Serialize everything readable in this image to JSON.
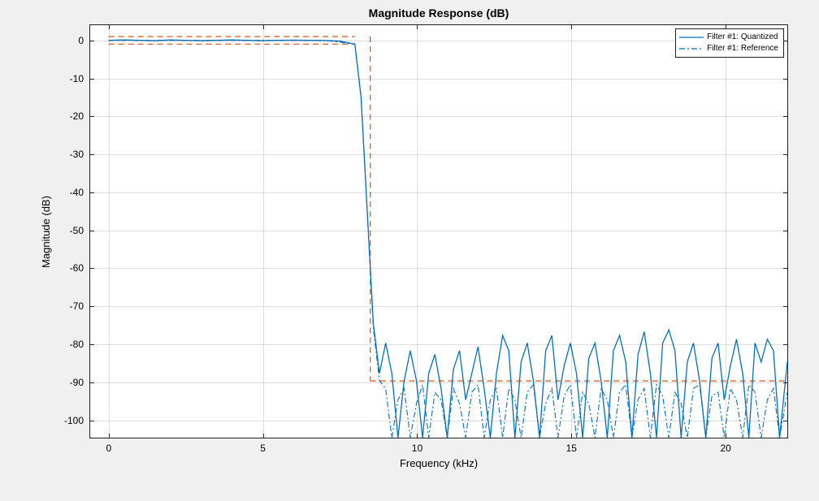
{
  "title": "Magnitude Response (dB)",
  "xlabel": "Frequency (kHz)",
  "ylabel": "Magnitude (dB)",
  "legend": {
    "items": [
      {
        "label": "Filter #1: Quantized",
        "style": "solid",
        "color": "#0072BD"
      },
      {
        "label": "Filter #1: Reference",
        "style": "dashdot",
        "color": "#0072BD"
      }
    ]
  },
  "colors": {
    "quantized": "#0072BD",
    "reference": "#0072BD",
    "mask": "#D95319"
  },
  "chart_data": {
    "type": "line",
    "xlabel": "Frequency (kHz)",
    "ylabel": "Magnitude (dB)",
    "title": "Magnitude Response (dB)",
    "xlim": [
      -0.6,
      22.05
    ],
    "ylim": [
      -105,
      4
    ],
    "xticks": [
      0,
      5,
      10,
      15,
      20
    ],
    "yticks": [
      0,
      -10,
      -20,
      -30,
      -40,
      -50,
      -60,
      -70,
      -80,
      -90,
      -100
    ],
    "grid": true,
    "legend_position": "northeast",
    "mask": {
      "color": "#D95319",
      "style": "dashed",
      "segments": [
        {
          "x": [
            0,
            8
          ],
          "y": [
            1,
            1
          ]
        },
        {
          "x": [
            0,
            8
          ],
          "y": [
            -1,
            -1
          ]
        },
        {
          "x": [
            8.5,
            8.5
          ],
          "y": [
            1,
            -90
          ]
        },
        {
          "x": [
            8.5,
            22.05
          ],
          "y": [
            -90,
            -90
          ]
        }
      ]
    },
    "series": [
      {
        "name": "Filter #1: Quantized",
        "color": "#0072BD",
        "style": "solid",
        "x": [
          0,
          0.5,
          1,
          1.5,
          2,
          2.5,
          3,
          3.5,
          4,
          4.5,
          5,
          5.5,
          6,
          6.5,
          7,
          7.5,
          8,
          8.2,
          8.4,
          8.6,
          8.8,
          9,
          9.2,
          9.4,
          9.6,
          9.8,
          10,
          10.2,
          10.4,
          10.6,
          10.8,
          11,
          11.2,
          11.4,
          11.6,
          11.8,
          12,
          12.2,
          12.4,
          12.6,
          12.8,
          13,
          13.2,
          13.4,
          13.6,
          13.8,
          14,
          14.2,
          14.4,
          14.6,
          14.8,
          15,
          15.2,
          15.4,
          15.6,
          15.8,
          16,
          16.2,
          16.4,
          16.6,
          16.8,
          17,
          17.2,
          17.4,
          17.6,
          17.8,
          18,
          18.2,
          18.4,
          18.6,
          18.8,
          19,
          19.2,
          19.4,
          19.6,
          19.8,
          20,
          20.2,
          20.4,
          20.6,
          20.8,
          21,
          21.2,
          21.4,
          21.6,
          21.8,
          22.05
        ],
        "y": [
          0,
          0.1,
          0,
          -0.1,
          0.1,
          0,
          -0.1,
          0,
          0.1,
          0,
          -0.1,
          0,
          0.05,
          0,
          -0.05,
          -0.2,
          -1,
          -15,
          -45,
          -75,
          -88,
          -80,
          -88,
          -105,
          -90,
          -82,
          -90,
          -105,
          -88,
          -83,
          -92,
          -105,
          -87,
          -82,
          -95,
          -88,
          -81,
          -92,
          -105,
          -88,
          -78,
          -82,
          -105,
          -85,
          -80,
          -90,
          -105,
          -82,
          -78,
          -95,
          -86,
          -80,
          -88,
          -105,
          -84,
          -80,
          -90,
          -105,
          -82,
          -78,
          -85,
          -105,
          -83,
          -77,
          -88,
          -105,
          -80,
          -76.5,
          -82,
          -105,
          -85,
          -80,
          -90,
          -105,
          -84,
          -80,
          -95,
          -86,
          -79,
          -88,
          -105,
          -80,
          -85,
          -79,
          -82,
          -105,
          -85
        ]
      },
      {
        "name": "Filter #1: Reference",
        "color": "#0072BD",
        "style": "dashdot",
        "x": [
          0,
          1,
          2,
          3,
          4,
          5,
          6,
          7,
          8,
          8.2,
          8.4,
          8.6,
          8.8,
          9,
          9.2,
          9.4,
          9.6,
          9.8,
          10,
          10.2,
          10.4,
          10.6,
          10.8,
          11,
          11.2,
          11.4,
          11.6,
          11.8,
          12,
          12.2,
          12.4,
          12.6,
          12.8,
          13,
          13.2,
          13.4,
          13.6,
          13.8,
          14,
          14.2,
          14.4,
          14.6,
          14.8,
          15,
          15.2,
          15.4,
          15.6,
          15.8,
          16,
          16.2,
          16.4,
          16.6,
          16.8,
          17,
          17.2,
          17.4,
          17.6,
          17.8,
          18,
          18.2,
          18.4,
          18.6,
          18.8,
          19,
          19.2,
          19.4,
          19.6,
          19.8,
          20,
          20.2,
          20.4,
          20.6,
          20.8,
          21,
          21.2,
          21.4,
          21.6,
          21.8,
          22.05
        ],
        "y": [
          0,
          0,
          0,
          0,
          0,
          0,
          0,
          0,
          -1,
          -15,
          -45,
          -76,
          -90,
          -92,
          -105,
          -95,
          -92,
          -105,
          -96,
          -91,
          -105,
          -93,
          -95,
          -105,
          -92,
          -96,
          -105,
          -93,
          -91,
          -105,
          -95,
          -92,
          -105,
          -92,
          -95,
          -105,
          -93,
          -91,
          -105,
          -96,
          -92,
          -105,
          -94,
          -91,
          -105,
          -93,
          -96,
          -105,
          -92,
          -95,
          -105,
          -93,
          -91,
          -105,
          -95,
          -92,
          -105,
          -91,
          -94,
          -105,
          -93,
          -96,
          -105,
          -92,
          -91,
          -105,
          -94,
          -93,
          -105,
          -92,
          -95,
          -105,
          -91,
          -93,
          -105,
          -95,
          -92,
          -105,
          -93
        ]
      }
    ]
  }
}
